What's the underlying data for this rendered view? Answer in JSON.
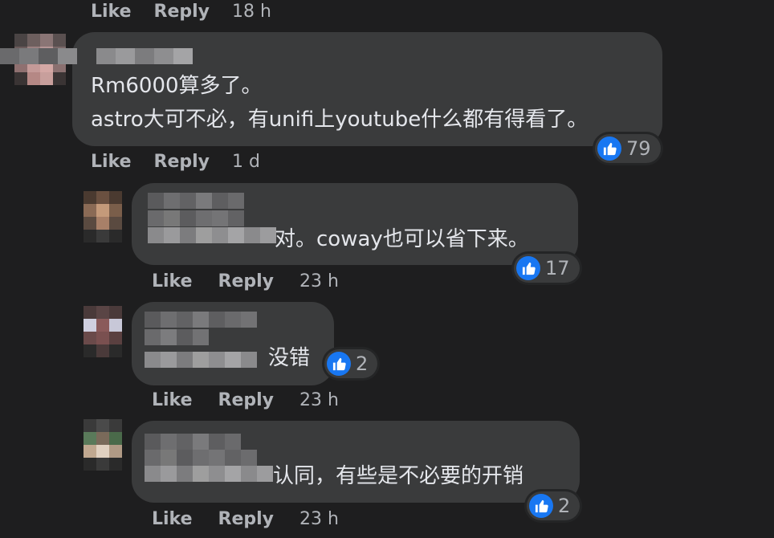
{
  "top_actions": {
    "like": "Like",
    "reply": "Reply",
    "time": "18 h"
  },
  "comments": [
    {
      "lines": [
        "Rm6000算多了。",
        "astro大可不必，有unifi上youtube什么都有得看了。"
      ],
      "reaction_count": "79",
      "actions": {
        "like": "Like",
        "reply": "Reply",
        "time": "1 d"
      }
    },
    {
      "text": "对。coway也可以省下来。",
      "reaction_count": "17",
      "actions": {
        "like": "Like",
        "reply": "Reply",
        "time": "23 h"
      }
    },
    {
      "text": "没错",
      "reaction_count": "2",
      "actions": {
        "like": "Like",
        "reply": "Reply",
        "time": "23 h"
      }
    },
    {
      "text": "认同，有些是不必要的开销",
      "reaction_count": "2",
      "actions": {
        "like": "Like",
        "reply": "Reply",
        "time": "23 h"
      }
    }
  ],
  "icons": {
    "reaction": "like-thumb-icon"
  },
  "colors": {
    "background": "#1e1e1f",
    "bubble": "#3a3b3c",
    "like_blue": "#1877f2",
    "meta_text": "#b0b3b8"
  }
}
